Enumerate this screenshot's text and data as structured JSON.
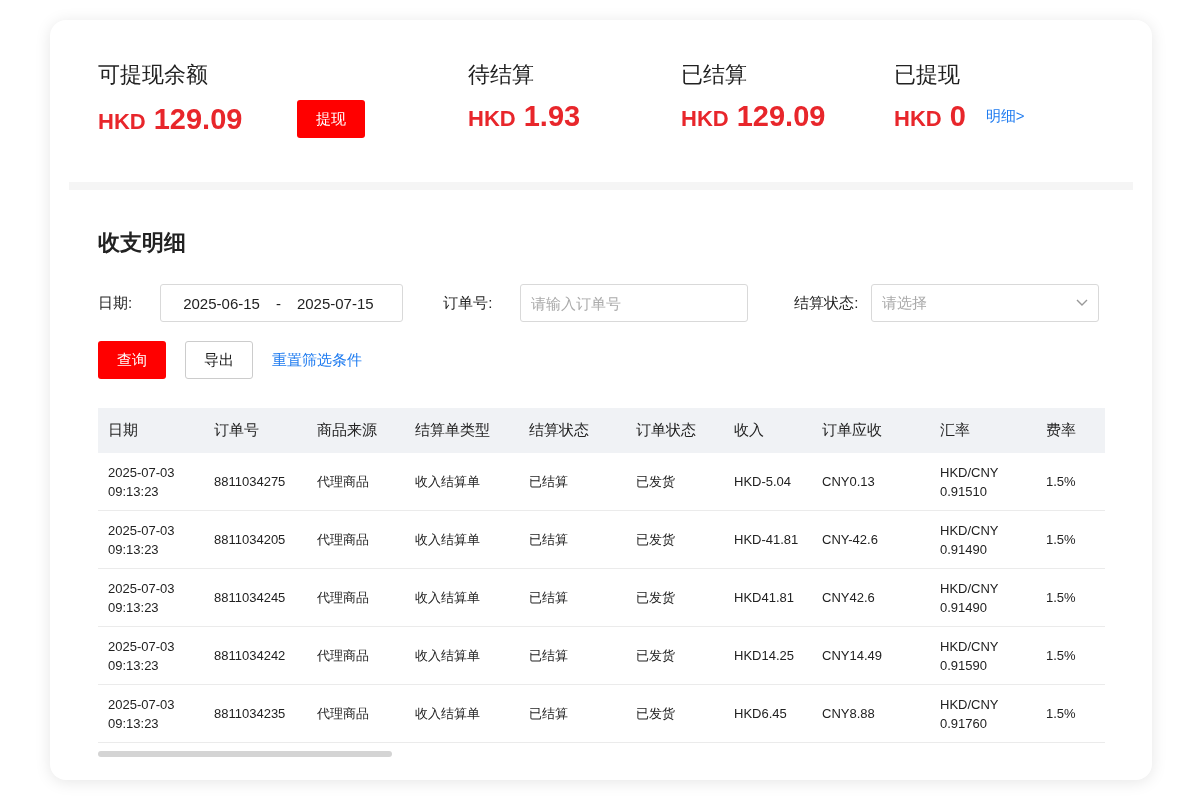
{
  "summary": [
    {
      "label": "可提现余额",
      "currency": "HKD",
      "amount": "129.09",
      "action": {
        "kind": "button",
        "label": "提现"
      }
    },
    {
      "label": "待结算",
      "currency": "HKD",
      "amount": "1.93"
    },
    {
      "label": "已结算",
      "currency": "HKD",
      "amount": "129.09"
    },
    {
      "label": "已提现",
      "currency": "HKD",
      "amount": "0",
      "action": {
        "kind": "link",
        "label": "明细>"
      }
    }
  ],
  "section_title": "收支明细",
  "filters": {
    "date_label": "日期:",
    "date_start": "2025-06-15",
    "date_sep": "-",
    "date_end": "2025-07-15",
    "order_label": "订单号:",
    "order_placeholder": "请输入订单号",
    "status_label": "结算状态:",
    "status_placeholder": "请选择"
  },
  "buttons": {
    "query": "查询",
    "export": "导出",
    "reset": "重置筛选条件"
  },
  "table": {
    "columns": [
      "日期",
      "订单号",
      "商品来源",
      "结算单类型",
      "结算状态",
      "订单状态",
      "收入",
      "订单应收",
      "汇率",
      "费率"
    ],
    "rows": [
      [
        "2025-07-03\n09:13:23",
        "8811034275",
        "代理商品",
        "收入结算单",
        "已结算",
        "已发货",
        "HKD-5.04",
        "CNY0.13",
        "HKD/CNY\n0.91510",
        "1.5%"
      ],
      [
        "2025-07-03\n09:13:23",
        "8811034205",
        "代理商品",
        "收入结算单",
        "已结算",
        "已发货",
        "HKD-41.81",
        "CNY-42.6",
        "HKD/CNY\n0.91490",
        "1.5%"
      ],
      [
        "2025-07-03\n09:13:23",
        "8811034245",
        "代理商品",
        "收入结算单",
        "已结算",
        "已发货",
        "HKD41.81",
        "CNY42.6",
        "HKD/CNY\n0.91490",
        "1.5%"
      ],
      [
        "2025-07-03\n09:13:23",
        "8811034242",
        "代理商品",
        "收入结算单",
        "已结算",
        "已发货",
        "HKD14.25",
        "CNY14.49",
        "HKD/CNY\n0.91590",
        "1.5%"
      ],
      [
        "2025-07-03\n09:13:23",
        "8811034235",
        "代理商品",
        "收入结算单",
        "已结算",
        "已发货",
        "HKD6.45",
        "CNY8.88",
        "HKD/CNY\n0.91760",
        "1.5%"
      ]
    ]
  }
}
